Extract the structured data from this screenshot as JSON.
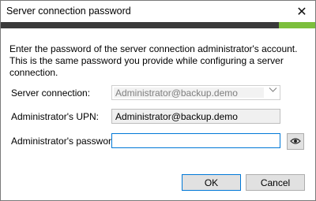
{
  "window": {
    "title": "Server connection password",
    "close_glyph": "✕",
    "accent_dark": "#3a3a3a",
    "accent_green": "#7cbf3c"
  },
  "dialog": {
    "description": "Enter the password of the server connection administrator's account. This is the same password you provide while configuring a server connection.",
    "server_connection": {
      "label": "Server connection:",
      "value": "Administrator@backup.demo",
      "icon": "chevron-down-icon"
    },
    "admin_upn": {
      "label": "Administrator's UPN:",
      "value": "Administrator@backup.demo"
    },
    "admin_password": {
      "label": "Administrator's password:",
      "value": "",
      "reveal_icon": "eye-icon"
    }
  },
  "buttons": {
    "ok_label": "OK",
    "cancel_label": "Cancel"
  }
}
